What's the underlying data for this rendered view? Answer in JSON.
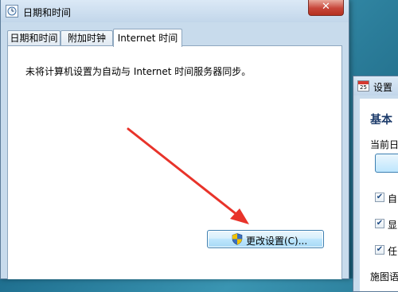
{
  "window": {
    "title": "日期和时间",
    "close_label": "✕"
  },
  "tabs": [
    {
      "label": "日期和时间"
    },
    {
      "label": "附加时钟"
    },
    {
      "label": "Internet 时间"
    }
  ],
  "panel": {
    "info_text": "未将计算机设置为自动与 Internet 时间服务器同步。",
    "change_button_label": "更改设置(C)..."
  },
  "settings_window": {
    "title": "设置",
    "calendar_icon_day": "25",
    "heading": "基本",
    "current_label": "当前日",
    "checkboxes": [
      {
        "label": "自",
        "checked": true
      },
      {
        "label": "显",
        "checked": true
      },
      {
        "label": "任",
        "checked": true
      }
    ],
    "bottom_label": "施图语"
  },
  "colors": {
    "arrow": "#e8332a",
    "close_button": "#c7463a"
  }
}
